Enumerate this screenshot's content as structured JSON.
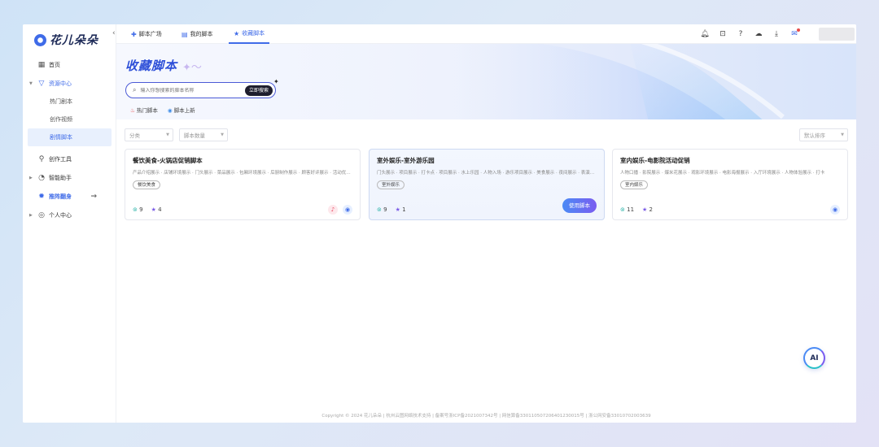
{
  "app": {
    "name": "花儿朵朵",
    "collapse_icon": "‹"
  },
  "sidebar": {
    "items": [
      {
        "label": "首页",
        "icon": "grid-icon"
      },
      {
        "label": "资源中心",
        "icon": "shield-icon"
      },
      {
        "label": "创作工具",
        "icon": "link-icon"
      },
      {
        "label": "智能助手",
        "icon": "clock-icon"
      },
      {
        "label": "推阵翻身",
        "icon": "gear-icon",
        "extra": "→"
      },
      {
        "label": "个人中心",
        "icon": "user-icon"
      }
    ],
    "sub_items": [
      {
        "label": "热门剧本"
      },
      {
        "label": "创作视频"
      },
      {
        "label": "剧情脚本"
      }
    ]
  },
  "tabs": [
    {
      "label": "脚本广场",
      "icon": "plus-icon"
    },
    {
      "label": "我的脚本",
      "icon": "doc-icon"
    },
    {
      "label": "收藏脚本",
      "icon": "star-icon"
    }
  ],
  "topbar_icons": [
    "bell-icon",
    "gift-icon",
    "help-icon",
    "cloud-icon",
    "download-icon",
    "mail-icon"
  ],
  "banner": {
    "title": "收藏脚本",
    "search_placeholder": "输入你想搜索的脚本名称",
    "search_button": "立即搜索",
    "hot_tags": [
      "热门脚本",
      "脚本上新"
    ]
  },
  "filters": {
    "category": "分类",
    "count": "脚本数量",
    "sort": "默认排序"
  },
  "cards": [
    {
      "title": "餐饮美食-火锅店促销脚本",
      "desc": "产品介绍展示 · 店铺环境展示 · 门头展示 · 菜品展示 · 包厢环境展示 · 后厨制作展示 · 顾客好评展示 · 活动优惠展示",
      "tag": "餐饮美食",
      "views": "9",
      "stars": "4",
      "badges": [
        "douyin-icon",
        "app-icon"
      ]
    },
    {
      "title": "室外娱乐-室外游乐园",
      "desc": "门头展示 · 项目展示 · 打卡点 · 项目展示 · 水上乐园 · 人物入场 · 游乐项目展示 · 美食展示 · 夜间展示 · 表演展示",
      "tag": "室外娱乐",
      "views": "9",
      "stars": "1",
      "use_button": "使用脚本",
      "badges": []
    },
    {
      "title": "室内娱乐-电影院活动促销",
      "desc": "人物口播 · 影院展示 · 爆米花展示 · 观影环境展示 · 电影海报展示 · 入厅环境展示 · 人物体验展示 · 打卡",
      "tag": "室内娱乐",
      "views": "11",
      "stars": "2",
      "badges": [
        "app-icon"
      ]
    }
  ],
  "footer": "Copyright © 2024 花儿朵朵 | 杭州云图网络技术支持 | 备案号浙ICP备2021007342号 | 网信算备330110507206401230015号 | 浙公网安备33010702003639",
  "ai_button": "AI"
}
